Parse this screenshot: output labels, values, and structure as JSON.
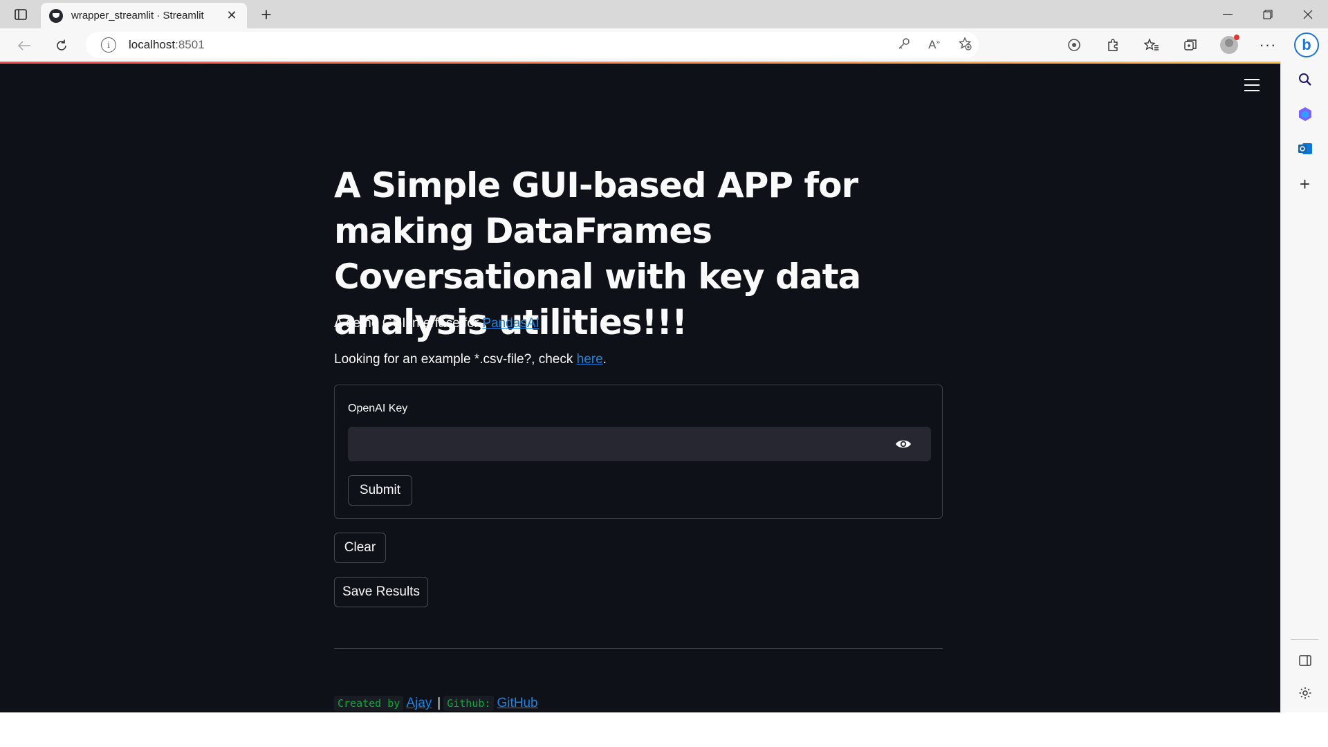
{
  "browser": {
    "tab_title": "wrapper_streamlit · Streamlit",
    "address_host": "localhost",
    "address_port": ":8501",
    "new_tab": "+",
    "tab_close": "✕"
  },
  "app": {
    "title": "A Simple GUI-based APP for making DataFrames Coversational with key data analysis utilities!!!",
    "intro_prefix": "A demo GUI interface for ",
    "intro_link": "PandasAI",
    "example_prefix": "Looking for an example *.csv-file?, check ",
    "example_link": "here",
    "example_suffix": ".",
    "form": {
      "key_label": "OpenAI Key",
      "key_value": "",
      "submit_label": "Submit"
    },
    "clear_label": "Clear",
    "save_label": "Save Results",
    "footer": {
      "created_by": "Created by",
      "author_link": "Ajay",
      "separator": "|",
      "github_label": "Github:",
      "github_link": "GitHub"
    }
  },
  "colors": {
    "app_background": "#0e1117",
    "link": "#1c83e1",
    "code_green": "#09ab3b",
    "input_background": "#262730"
  }
}
